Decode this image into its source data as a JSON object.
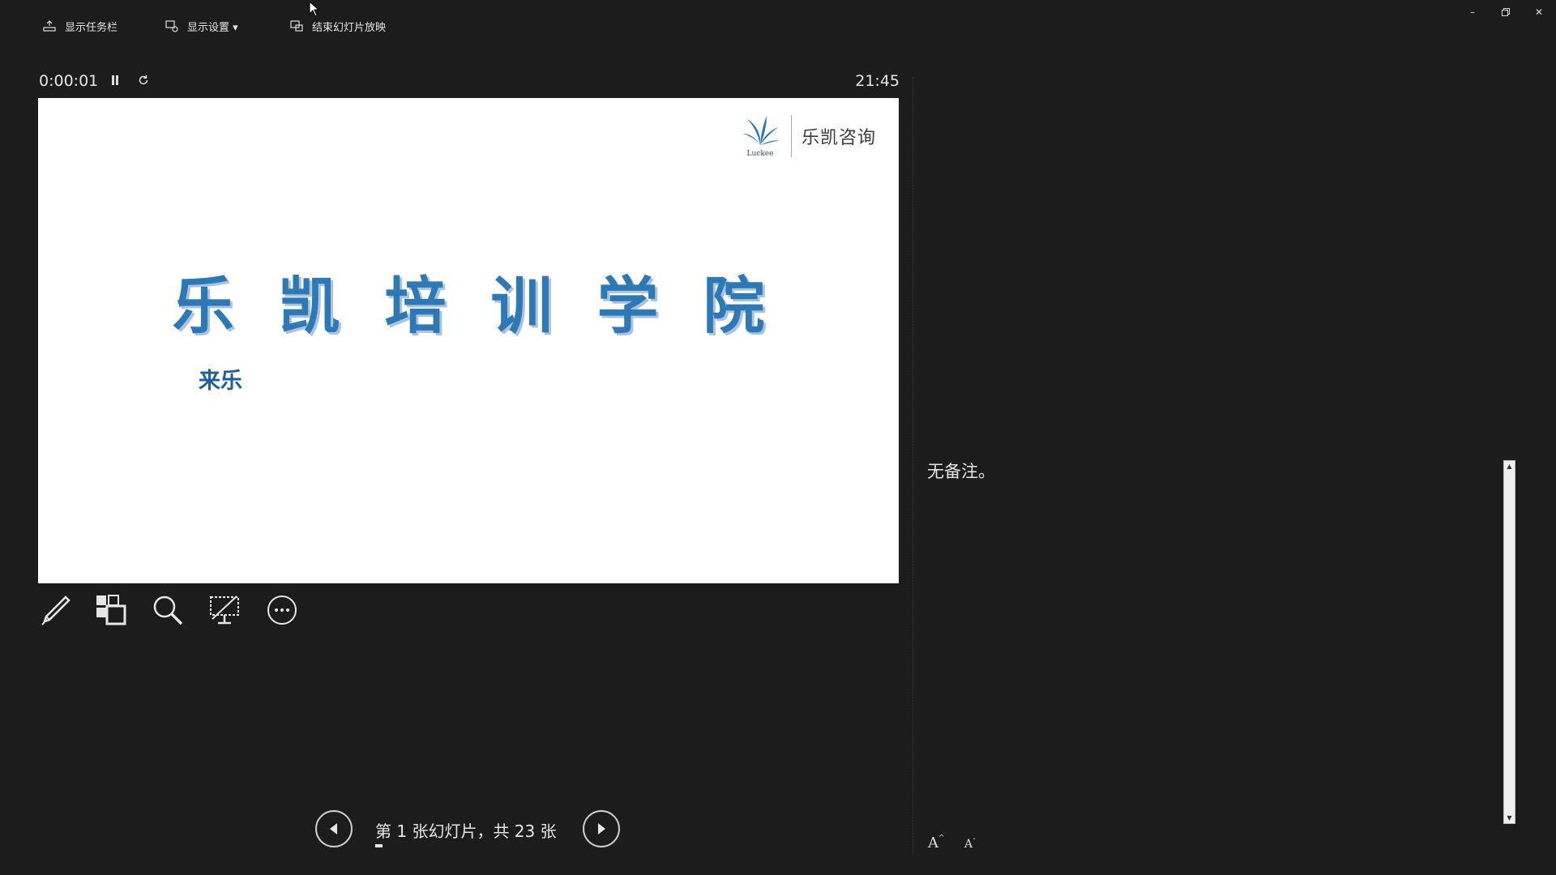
{
  "toolbar": {
    "show_taskbar": "显示任务栏",
    "display_settings": "显示设置 ▾",
    "end_show": "结束幻灯片放映"
  },
  "status": {
    "elapsed": "0:00:01",
    "clock": "21:45"
  },
  "slide": {
    "logo_text": "乐凯咨询",
    "logo_mark_text": "Luckee",
    "title": "乐凯培训学院",
    "subtitle": "来乐",
    "title_color": "#2e78b6"
  },
  "notes": {
    "text": "无备注。"
  },
  "navigation": {
    "counter": "第 1 张幻灯片，共 23 张"
  },
  "tools": [
    "pen-icon",
    "slides-grid-icon",
    "zoom-icon",
    "screen-toggle-icon",
    "more-options-icon"
  ],
  "colors": {
    "background": "#1c1c1c",
    "accent": "#2e78b6"
  }
}
